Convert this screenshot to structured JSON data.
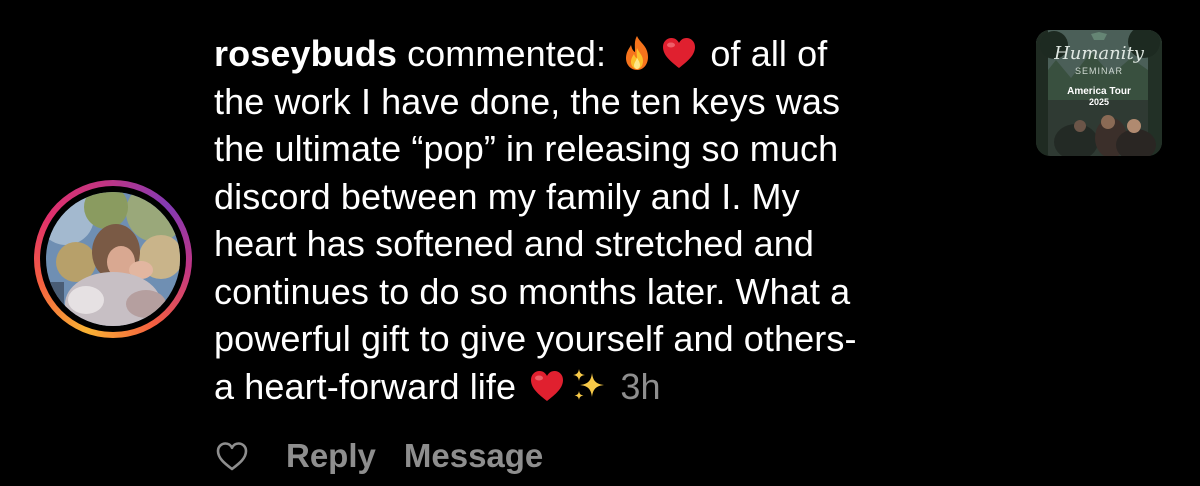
{
  "comment": {
    "username": "roseybuds",
    "verb": " commented: ",
    "line1_tail": " of all of",
    "line2": "the work I have done, the ten keys was",
    "line3": "the ultimate “pop” in releasing so much",
    "line4": "discord between my family and I. My",
    "line5": "heart has softened and stretched and",
    "line6": "continues to do so months later. What a",
    "line7": "powerful gift to give yourself and others-",
    "line8": "a heart-forward life ",
    "timestamp": "3h",
    "emojis": [
      "fire-emoji",
      "red-heart-emoji",
      "red-heart-emoji",
      "sparkles-emoji"
    ]
  },
  "actions": {
    "like_icon": "heart-outline-icon",
    "reply_label": "Reply",
    "message_label": "Message"
  },
  "post_thumbnail": {
    "title": "Humanity",
    "subtitle": "SEMINAR",
    "tour": "America Tour",
    "year": "2025"
  },
  "colors": {
    "background": "#000000",
    "text": "#ffffff",
    "muted": "#8e8e8e",
    "heart": "#e0202f"
  }
}
